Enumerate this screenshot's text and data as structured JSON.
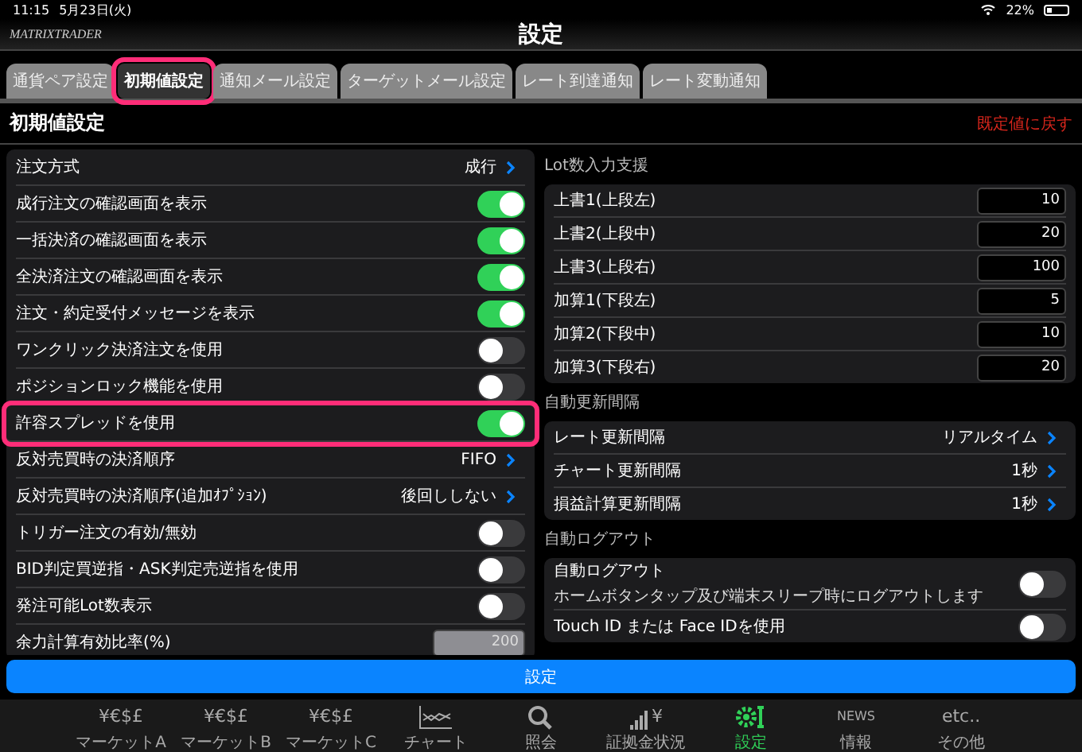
{
  "status_bar": {
    "time": "11:15",
    "date": "5月23日(火)",
    "battery": "22%"
  },
  "app_bar": {
    "logo": "MATRIXTRADER",
    "title": "設定"
  },
  "tabs": [
    {
      "label": "通貨ペア設定",
      "selected": false,
      "highlighted": false
    },
    {
      "label": "初期値設定",
      "selected": true,
      "highlighted": true
    },
    {
      "label": "通知メール設定",
      "selected": false,
      "highlighted": false
    },
    {
      "label": "ターゲットメール設定",
      "selected": false,
      "highlighted": false
    },
    {
      "label": "レート到達通知",
      "selected": false,
      "highlighted": false
    },
    {
      "label": "レート変動通知",
      "selected": false,
      "highlighted": false
    }
  ],
  "section": {
    "title": "初期値設定",
    "reset_link": "既定値に戻す"
  },
  "left_rows": [
    {
      "kind": "link",
      "label": "注文方式",
      "value": "成行",
      "highlighted": false
    },
    {
      "kind": "toggle",
      "label": "成行注文の確認画面を表示",
      "on": true,
      "highlighted": false
    },
    {
      "kind": "toggle",
      "label": "一括決済の確認画面を表示",
      "on": true,
      "highlighted": false
    },
    {
      "kind": "toggle",
      "label": "全決済注文の確認画面を表示",
      "on": true,
      "highlighted": false
    },
    {
      "kind": "toggle",
      "label": "注文・約定受付メッセージを表示",
      "on": true,
      "highlighted": false
    },
    {
      "kind": "toggle",
      "label": "ワンクリック決済注文を使用",
      "on": false,
      "highlighted": false
    },
    {
      "kind": "toggle",
      "label": "ポジションロック機能を使用",
      "on": false,
      "highlighted": false
    },
    {
      "kind": "toggle",
      "label": "許容スプレッドを使用",
      "on": true,
      "highlighted": true
    },
    {
      "kind": "link",
      "label": "反対売買時の決済順序",
      "value": "FIFO",
      "highlighted": false
    },
    {
      "kind": "link",
      "label": "反対売買時の決済順序(追加ｵﾌﾟｼｮﾝ)",
      "value": "後回ししない",
      "highlighted": false
    },
    {
      "kind": "toggle",
      "label": "トリガー注文の有効/無効",
      "on": false,
      "highlighted": false
    },
    {
      "kind": "toggle",
      "label": "BID判定買逆指・ASK判定売逆指を使用",
      "on": false,
      "highlighted": false
    },
    {
      "kind": "toggle",
      "label": "発注可能Lot数表示",
      "on": false,
      "highlighted": false
    },
    {
      "kind": "input",
      "label": "余力計算有効比率(%)",
      "value": "200",
      "disabled": true,
      "highlighted": false
    }
  ],
  "right_groups": [
    {
      "title": "Lot数入力支援",
      "rows": [
        {
          "kind": "input",
          "label": "上書1(上段左)",
          "value": "10",
          "disabled": false
        },
        {
          "kind": "input",
          "label": "上書2(上段中)",
          "value": "20",
          "disabled": false
        },
        {
          "kind": "input",
          "label": "上書3(上段右)",
          "value": "100",
          "disabled": false
        },
        {
          "kind": "input",
          "label": "加算1(下段左)",
          "value": "5",
          "disabled": false
        },
        {
          "kind": "input",
          "label": "加算2(下段中)",
          "value": "10",
          "disabled": false
        },
        {
          "kind": "input",
          "label": "加算3(下段右)",
          "value": "20",
          "disabled": false
        }
      ]
    },
    {
      "title": "自動更新間隔",
      "rows": [
        {
          "kind": "link",
          "label": "レート更新間隔",
          "value": "リアルタイム"
        },
        {
          "kind": "link",
          "label": "チャート更新間隔",
          "value": "1秒"
        },
        {
          "kind": "link",
          "label": "損益計算更新間隔",
          "value": "1秒"
        }
      ]
    },
    {
      "title": "自動ログアウト",
      "rows": [
        {
          "kind": "toggle",
          "label": "自動ログアウト",
          "note": "ホームボタンタップ及び端末スリープ時にログアウトします",
          "on": false
        },
        {
          "kind": "toggle",
          "label": "Touch ID または Face IDを使用",
          "on": false
        }
      ]
    }
  ],
  "submit_button": "設定",
  "bottom_nav": [
    {
      "kind": "currency",
      "icon_text": "¥€$£",
      "label": "マーケットA",
      "selected": false
    },
    {
      "kind": "currency",
      "icon_text": "¥€$£",
      "label": "マーケットB",
      "selected": false
    },
    {
      "kind": "currency",
      "icon_text": "¥€$£",
      "label": "マーケットC",
      "selected": false
    },
    {
      "kind": "chart",
      "label": "チャート",
      "selected": false
    },
    {
      "kind": "search",
      "label": "照会",
      "selected": false
    },
    {
      "kind": "margin",
      "icon_text": "¥",
      "label": "証拠金状況",
      "selected": false
    },
    {
      "kind": "settings",
      "label": "設定",
      "selected": true
    },
    {
      "kind": "news",
      "icon_text": "NEWS",
      "label": "情報",
      "selected": false
    },
    {
      "kind": "more",
      "icon_text": "etc..",
      "label": "その他",
      "selected": false
    }
  ]
}
